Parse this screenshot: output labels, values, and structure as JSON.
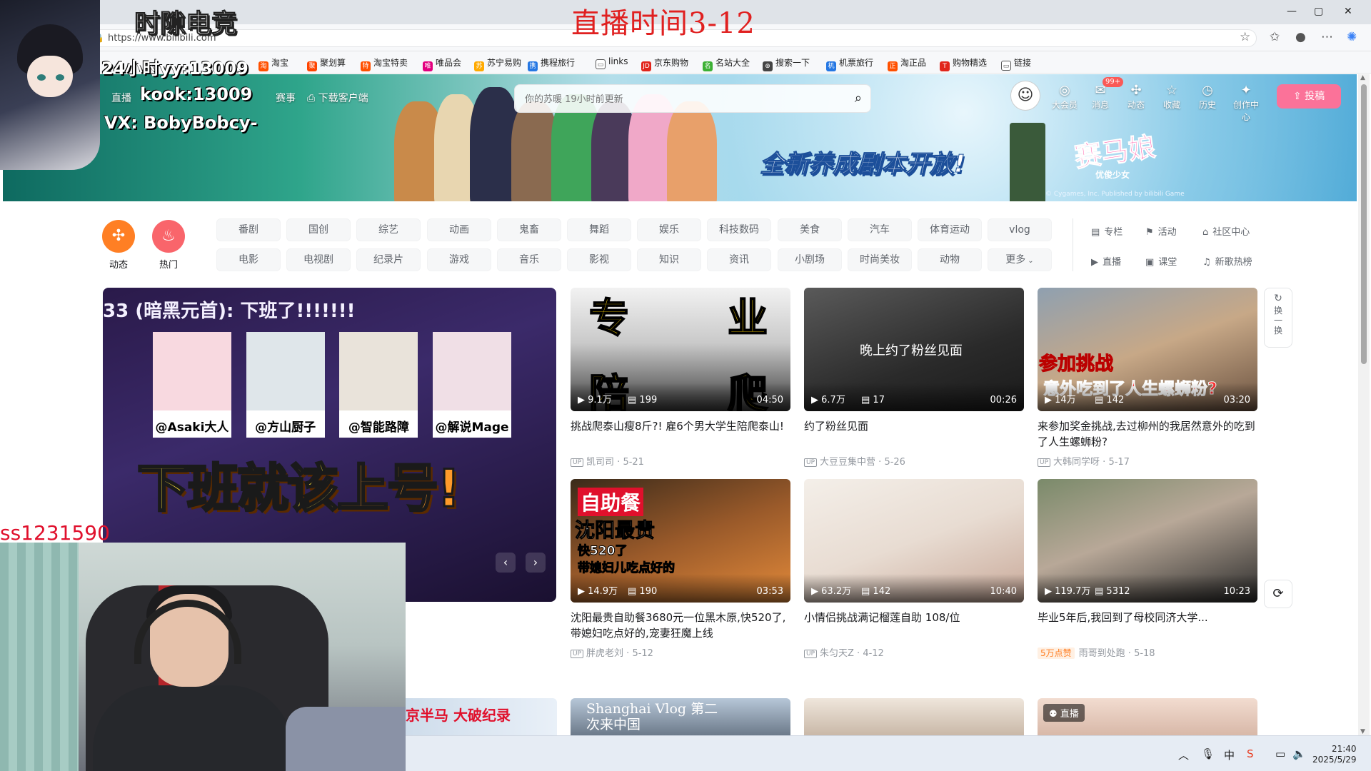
{
  "browser": {
    "url": "https://www.bilibili.com",
    "window_controls": [
      "—",
      "▢",
      "✕"
    ]
  },
  "bookmarks": [
    {
      "label": "淘宝",
      "color": "#ff5000",
      "glyph": "淘"
    },
    {
      "label": "聚划算",
      "color": "#ff4400",
      "glyph": "聚"
    },
    {
      "label": "淘宝特卖",
      "color": "#ff5000",
      "glyph": "特"
    },
    {
      "label": "唯品会",
      "color": "#e3007f",
      "glyph": "唯"
    },
    {
      "label": "苏宁易购",
      "color": "#ffaa00",
      "glyph": "苏"
    },
    {
      "label": "携程旅行",
      "color": "#2577e3",
      "glyph": "携"
    },
    {
      "label": "links",
      "color": "#ffffff",
      "glyph": "▭"
    },
    {
      "label": "京东购物",
      "color": "#e1251b",
      "glyph": "JD"
    },
    {
      "label": "名站大全",
      "color": "#3cb034",
      "glyph": "名"
    },
    {
      "label": "搜索一下",
      "color": "#444444",
      "glyph": "⊕"
    },
    {
      "label": "机票旅行",
      "color": "#2577e3",
      "glyph": "机"
    },
    {
      "label": "淘正品",
      "color": "#ff5000",
      "glyph": "正"
    },
    {
      "label": "购物精选",
      "color": "#e1251b",
      "glyph": "T"
    },
    {
      "label": "链接",
      "color": "#ffffff",
      "glyph": "▭"
    }
  ],
  "overlay": {
    "stream_title": "直播时间3-12",
    "panel_banner": "时隙电竞",
    "yy_line": "24小时yy:",
    "yy_number": "13009",
    "kook_line": "kook:",
    "kook_number": "13009",
    "vx_line": "VX: BobyBobcy-",
    "cam_label": "ss1231590"
  },
  "header": {
    "left_entry": "直播",
    "match_entry": "赛事",
    "download_label": "下载客户端",
    "search_placeholder": "你的苏暖 19小时前更新",
    "entries": [
      {
        "icon": "大会员",
        "glyph": "◎",
        "label": "大会员"
      },
      {
        "icon": "消息",
        "glyph": "✉",
        "label": "消息"
      },
      {
        "icon": "动态",
        "glyph": "✣",
        "label": "动态"
      },
      {
        "icon": "收藏",
        "glyph": "☆",
        "label": "收藏"
      },
      {
        "icon": "历史",
        "glyph": "◷",
        "label": "历史"
      },
      {
        "icon": "创作中心",
        "glyph": "✦",
        "label": "创作中心"
      }
    ],
    "message_badge": "99+",
    "upload_label": "投稿",
    "game_slogan": "全新养成剧本开放!",
    "game_logo": "赛马娘",
    "game_sub": "优俊少女",
    "publisher": "© Cygames, Inc. Published by bilibili Game"
  },
  "channels": {
    "round": [
      {
        "label": "动态",
        "color": "#ff7f24",
        "glyph": "✣"
      },
      {
        "label": "热门",
        "color": "#f9656b",
        "glyph": "♨"
      }
    ],
    "row1": [
      "番剧",
      "国创",
      "综艺",
      "动画",
      "鬼畜",
      "舞蹈",
      "娱乐",
      "科技数码",
      "美食",
      "汽车",
      "体育运动",
      "vlog"
    ],
    "row2": [
      "电影",
      "电视剧",
      "纪录片",
      "游戏",
      "音乐",
      "影视",
      "知识",
      "资讯",
      "小剧场",
      "时尚美妆",
      "动物",
      "更多"
    ],
    "side": [
      {
        "glyph": "▤",
        "label": "专栏"
      },
      {
        "glyph": "⚑",
        "label": "活动"
      },
      {
        "glyph": "⌂",
        "label": "社区中心"
      },
      {
        "glyph": "▶",
        "label": "直播"
      },
      {
        "glyph": "▣",
        "label": "课堂"
      },
      {
        "glyph": "♫",
        "label": "新歌热榜"
      }
    ]
  },
  "carousel": {
    "caption_top": "33 (暗黑元首): 下班了!!!!!!!",
    "cast": [
      "@Asaki大人",
      "@方山厨子",
      "@智能路障",
      "@解说Mage"
    ],
    "slogan_a": "下班就该",
    "slogan_b": "上号!",
    "prev": "‹",
    "next": "›"
  },
  "videos": [
    {
      "title": "挑战爬泰山瘦8斤?! 雇6个男大学生陪爬泰山!",
      "author": "凯司司",
      "date": "5-21",
      "views": "9.1万",
      "danmaku": "199",
      "duration": "04:50",
      "thumb_text": [
        "专",
        "业",
        "陪",
        "爬"
      ],
      "tag": ""
    },
    {
      "title": "约了粉丝见面",
      "author": "大豆豆集中营",
      "date": "5-26",
      "views": "6.7万",
      "danmaku": "17",
      "duration": "00:26",
      "thumb_text": [
        "晚上约了粉丝见面"
      ],
      "tag": ""
    },
    {
      "title": "来参加奖金挑战,去过柳州的我居然意外的吃到了人生螺蛳粉?",
      "author": "大韩同学呀",
      "date": "5-17",
      "views": "14万",
      "danmaku": "142",
      "duration": "03:20",
      "thumb_text": [
        "参加挑战",
        "意外吃到了人生螺蛳粉?"
      ],
      "tag": ""
    },
    {
      "title": "沈阳最贵自助餐3680元一位黑木原,快520了,带媳妇吃点好的,宠妻狂魔上线",
      "author": "胖虎老刘",
      "date": "5-12",
      "views": "14.9万",
      "danmaku": "190",
      "duration": "03:53",
      "thumb_text": [
        "自助餐",
        "沈阳最贵",
        "快520了",
        "带媳妇儿吃点好的"
      ],
      "tag": ""
    },
    {
      "title": "小情侣挑战满记榴莲自助 108/位",
      "author": "朱匀天Z",
      "date": "4-12",
      "views": "63.2万",
      "danmaku": "142",
      "duration": "10:40",
      "thumb_text": [],
      "tag": ""
    },
    {
      "title": "毕业5年后,我回到了母校同济大学...",
      "author": "雨哥到处跑",
      "date": "5-18",
      "views": "119.7万",
      "danmaku": "5312",
      "duration": "10:23",
      "thumb_text": [],
      "tag": "5万点赞"
    }
  ],
  "bottom_row": {
    "card1_text": "京半马 大破纪录",
    "card2_text": "Shanghai Vlog 第二次来中国",
    "card4_badge": "直播"
  },
  "refresh": {
    "label": "换一换",
    "glyph": "↻"
  },
  "reload_glyph": "⟳",
  "taskbar": {
    "time": "21:40",
    "date": "2025/5/29"
  }
}
